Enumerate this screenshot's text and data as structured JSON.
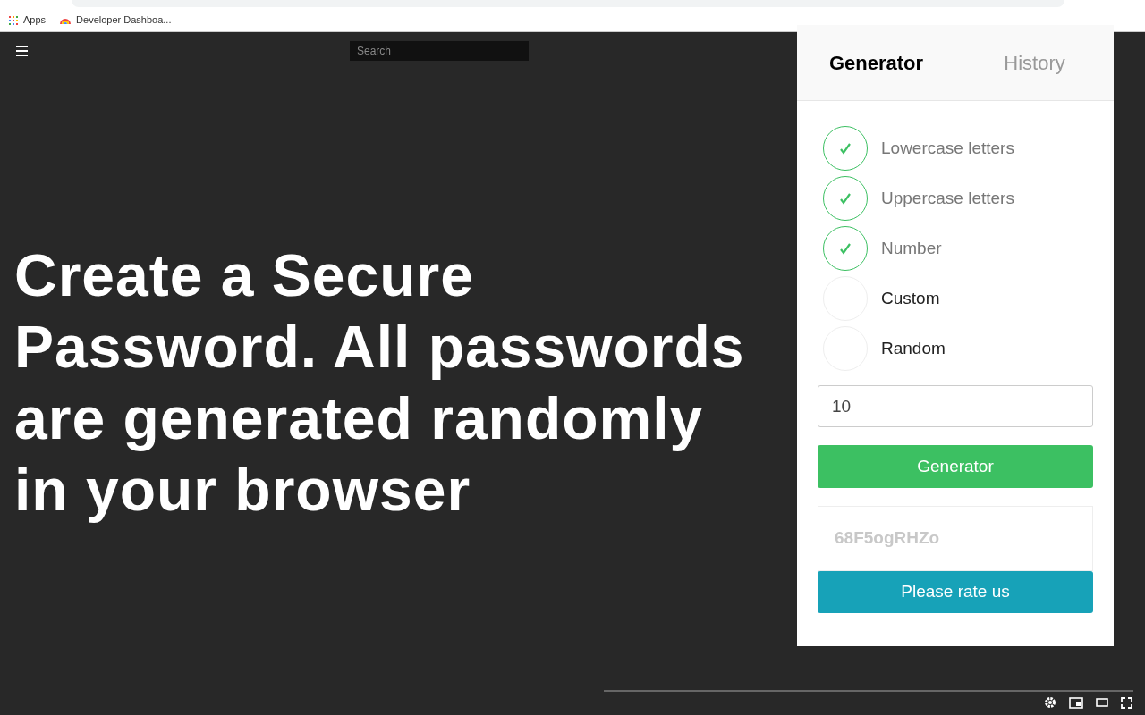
{
  "browser": {
    "bookmarks": [
      "Apps",
      "Developer Dashboa..."
    ]
  },
  "page": {
    "search": {
      "placeholder": "Search"
    },
    "headline": "Create a Secure Password. All passwords are generated randomly in your browser"
  },
  "popup": {
    "tabs": [
      {
        "label": "Generator",
        "selected": true
      },
      {
        "label": "History",
        "selected": false
      }
    ],
    "options": [
      {
        "label": "Lowercase letters",
        "checked": true
      },
      {
        "label": "Uppercase letters",
        "checked": true
      },
      {
        "label": "Number",
        "checked": true
      },
      {
        "label": "Custom",
        "checked": false
      },
      {
        "label": "Random",
        "checked": false
      }
    ],
    "length": "10",
    "generate_button": "Generator",
    "password": "68F5ogRHZo",
    "rate_button": "Please rate us"
  }
}
